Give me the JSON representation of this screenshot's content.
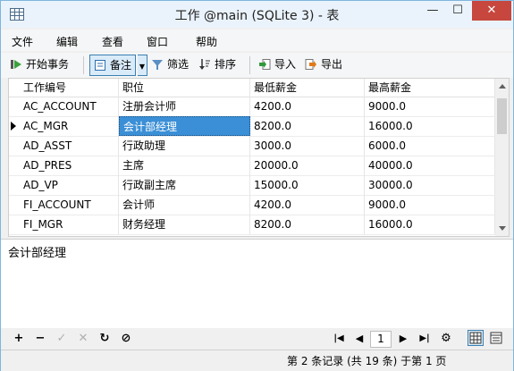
{
  "window": {
    "title": "工作 @main (SQLite 3) - 表",
    "minimize": "—",
    "maximize": "☐",
    "close": "✕"
  },
  "menu": [
    "文件",
    "编辑",
    "查看",
    "窗口",
    "帮助"
  ],
  "toolbar": {
    "begin_transaction": "开始事务",
    "memo": "备注",
    "filter": "筛选",
    "sort": "排序",
    "import": "导入",
    "export": "导出"
  },
  "table": {
    "columns": [
      "工作编号",
      "职位",
      "最低薪金",
      "最高薪金"
    ],
    "rows": [
      [
        "AC_ACCOUNT",
        "注册会计师",
        "4200.0",
        "9000.0"
      ],
      [
        "AC_MGR",
        "会计部经理",
        "8200.0",
        "16000.0"
      ],
      [
        "AD_ASST",
        "行政助理",
        "3000.0",
        "6000.0"
      ],
      [
        "AD_PRES",
        "主席",
        "20000.0",
        "40000.0"
      ],
      [
        "AD_VP",
        "行政副主席",
        "15000.0",
        "30000.0"
      ],
      [
        "FI_ACCOUNT",
        "会计师",
        "4200.0",
        "9000.0"
      ],
      [
        "FI_MGR",
        "财务经理",
        "8200.0",
        "16000.0"
      ]
    ],
    "selected_row": 1
  },
  "editor": {
    "value": "会计部经理"
  },
  "navigation": {
    "page": "1"
  },
  "status": "第 2 条记录 (共 19 条) 于第 1 页",
  "colors": {
    "accent": "#3b8fd6",
    "close": "#c7463d",
    "title_bg": "#eaf3fb"
  }
}
